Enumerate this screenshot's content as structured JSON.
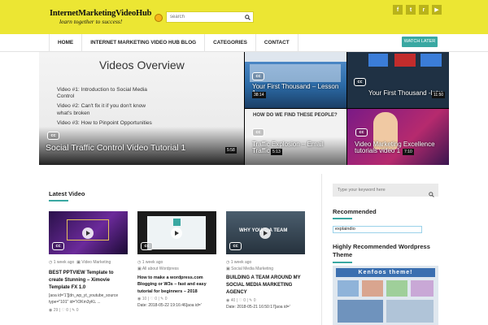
{
  "header": {
    "logo_title": "InternetMarketingVideoHub",
    "logo_tagline": "learn together to success!",
    "search_placeholder": "search",
    "social": [
      {
        "name": "facebook-icon",
        "glyph": "f"
      },
      {
        "name": "twitter-icon",
        "glyph": "t"
      },
      {
        "name": "rss-icon",
        "glyph": "r"
      },
      {
        "name": "youtube-icon",
        "glyph": "▶"
      }
    ]
  },
  "nav": {
    "items": [
      "HOME",
      "INTERNET MARKETING VIDEO HUB BLOG",
      "CATEGORIES",
      "CONTACT"
    ],
    "watch_later": "WATCH LATER"
  },
  "hero": {
    "main": {
      "slide_heading": "Videos Overview",
      "slide_bullets": [
        "Video #1: Introduction to Social Media Control",
        "Video #2: Can't fix it if you don't know what's broken",
        "Video #3: How to Pinpoint Opportunities"
      ],
      "title": "Social Traffic Control Video Tutorial 1",
      "duration": "5:58"
    },
    "tiles": [
      {
        "title": "Your First Thousand – Lesson 1",
        "duration": "38:14"
      },
      {
        "title": "Your First Thousand -Intro",
        "duration": "11:50"
      },
      {
        "title": "Traffic Explosion – Email Traffic",
        "duration": "5:13",
        "banner": "HOW DO WE FIND THESE PEOPLE?"
      },
      {
        "title": "Video Marketing Excellence tutorials video 1",
        "duration": "7:10"
      }
    ],
    "cc_label": "cc"
  },
  "latest": {
    "heading": "Latest Video",
    "cards": [
      {
        "date": "1 week ago",
        "category": "Video Marketing",
        "title": "BEST PPTVIEW Template to create Stunning – Ximovie Template FX 1.0",
        "excerpt": "[aoa id='1'][dn_wp_yt_youtube_source type=\"101\" id=\"iOKm3yKL ...",
        "views": "29",
        "likes": "0",
        "comments": "0"
      },
      {
        "date": "1 week ago",
        "category": "All about Wordpress",
        "title": "How to make a wordpress.com Blogging or W3s – fast and easy tutorial for beginners – 2018",
        "excerpt": "Date: 2018-05-22 19:16:46[aoa id='",
        "views": "10",
        "likes": "0",
        "comments": "0"
      },
      {
        "date": "1 week ago",
        "category": "Social Media Marketing",
        "title": "BUILDING A TEAM AROUND MY SOCIAL MEDIA MARKETING AGENCY",
        "excerpt": "Date: 2018-05-21 16:50:17[aoa id='",
        "views": "40",
        "likes": "0",
        "comments": "0",
        "thumb_text": "WHY YOU ... A TEAM"
      }
    ]
  },
  "sidebar": {
    "search_placeholder": "Type your keyword here",
    "recommended_heading": "Recommended",
    "recommended_value": "explaindio",
    "wp_heading": "Highly Recommended Wordpress Theme",
    "theme_banner": "Kenfoos theme!"
  },
  "colors": {
    "header_yellow": "#ece633",
    "accent_teal": "#3aa8a2"
  }
}
